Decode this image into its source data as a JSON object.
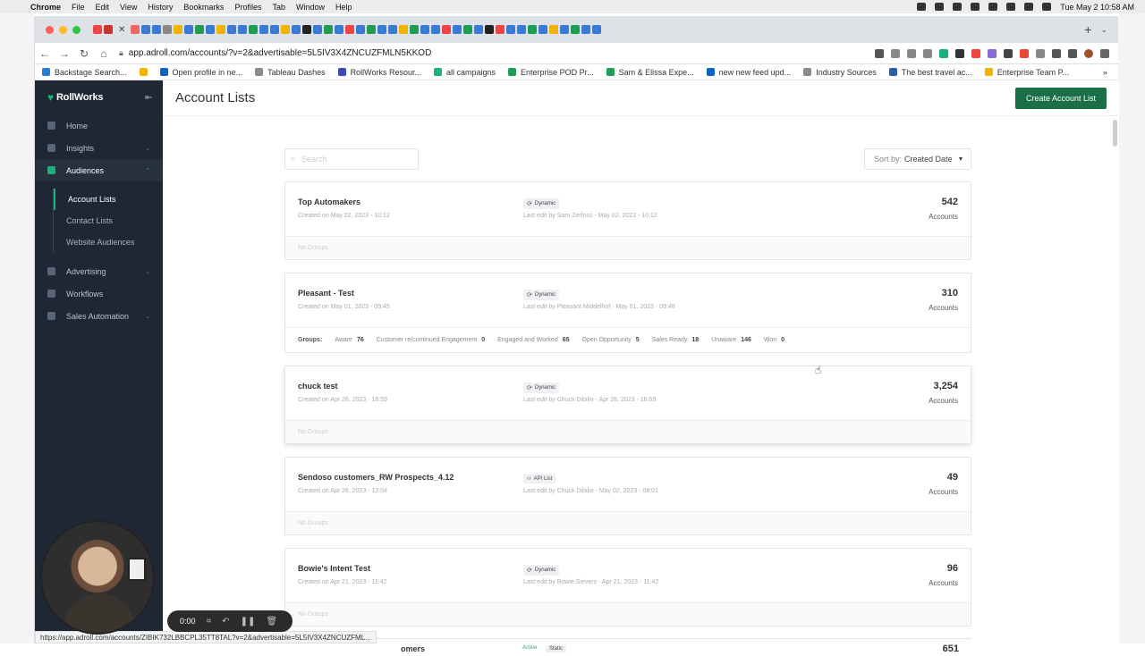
{
  "macos": {
    "menus": [
      "Chrome",
      "File",
      "Edit",
      "View",
      "History",
      "Bookmarks",
      "Profiles",
      "Tab",
      "Window",
      "Help"
    ],
    "clock": "Tue May 2  10:58 AM"
  },
  "browser": {
    "url_host": "app.adroll.com",
    "url_path": "/accounts/?v=2&advertisable=5L5IV3X4ZNCUZFMLN5KKOD",
    "status_url": "https://app.adroll.com/accounts/ZIBIK732LBBCPL35TT8TAL?v=2&advertisable=5L5IV3X4ZNCUZFML...",
    "bookmarks": [
      {
        "label": "Backstage Search...",
        "color": "#2b7cd3"
      },
      {
        "label": "",
        "color": "#f0b400"
      },
      {
        "label": "Open profile in ne...",
        "color": "#0a66c2"
      },
      {
        "label": "Tableau Dashes",
        "color": "#8a8a8a"
      },
      {
        "label": "RollWorks Resour...",
        "color": "#3b4bb0"
      },
      {
        "label": "all campaigns",
        "color": "#19b27a"
      },
      {
        "label": "Enterprise POD Pr...",
        "color": "#1f9d55"
      },
      {
        "label": "Sam & Elissa Expe...",
        "color": "#1f9d55"
      },
      {
        "label": "new new feed upd...",
        "color": "#0a66c2"
      },
      {
        "label": "Industry Sources",
        "color": "#8a8a8a"
      },
      {
        "label": "The best travel ac...",
        "color": "#2b5ca8"
      },
      {
        "label": "Enterprise Team P...",
        "color": "#f0b400"
      }
    ],
    "more_bookmarks": "»"
  },
  "sidebar": {
    "brand": "RollWorks",
    "items": [
      {
        "label": "Home",
        "active": false,
        "chevron": false
      },
      {
        "label": "Insights",
        "active": false,
        "chevron": true
      },
      {
        "label": "Audiences",
        "active": true,
        "chevron": true
      }
    ],
    "subitems": [
      {
        "label": "Account Lists",
        "active": true
      },
      {
        "label": "Contact Lists",
        "active": false
      },
      {
        "label": "Website Audiences",
        "active": false
      }
    ],
    "items_after": [
      {
        "label": "Advertising",
        "chevron": true
      },
      {
        "label": "Workflows",
        "chevron": false
      },
      {
        "label": "Sales Automation",
        "chevron": true
      }
    ]
  },
  "page": {
    "title": "Account Lists",
    "create_button": "Create Account List",
    "search_placeholder": "Search",
    "sort_label": "Sort by:",
    "sort_value": "Created Date"
  },
  "cards": [
    {
      "name": "Top Automakers",
      "created": "Created on May 02, 2023 - 10:12",
      "type": "Dynamic",
      "edit": "Last edit by Sam Zerfoss - May 02, 2023 - 10:12",
      "count": "542",
      "unit": "Accounts",
      "groups_text": "No Groups",
      "groups": []
    },
    {
      "name": "Pleasant - Test",
      "created": "Created on May 01, 2023 - 09:45",
      "type": "Dynamic",
      "edit": "Last edit by Pleasant Middelhof - May 01, 2023 - 09:48",
      "count": "310",
      "unit": "Accounts",
      "groups_label": "Groups:",
      "groups": [
        {
          "name": "Aware",
          "count": "76"
        },
        {
          "name": "Customer re/continued Engagement",
          "count": "0"
        },
        {
          "name": "Engaged and Worked",
          "count": "65"
        },
        {
          "name": "Open Opportunity",
          "count": "5"
        },
        {
          "name": "Sales Ready",
          "count": "18"
        },
        {
          "name": "Unaware",
          "count": "146"
        },
        {
          "name": "Won",
          "count": "0"
        }
      ]
    },
    {
      "name": "chuck test",
      "created": "Created on Apr 26, 2023 - 16:59",
      "type": "Dynamic",
      "edit": "Last edit by Chuck Dibilio - Apr 26, 2023 - 16:59",
      "count": "3,254",
      "unit": "Accounts",
      "groups_text": "No Groups",
      "groups": []
    },
    {
      "name": "Sendoso customers_RW Prospects_4.12",
      "created": "Created on Apr 26, 2023 - 12:04",
      "type": "API List",
      "edit": "Last edit by Chuck Dibilio - May 02, 2023 - 08:01",
      "count": "49",
      "unit": "Accounts",
      "groups_text": "No Groups",
      "groups": []
    },
    {
      "name": "Bowie's Intent Test",
      "created": "Created on Apr 21, 2023 - 11:42",
      "type": "Dynamic",
      "edit": "Last edit by Bowie Sievers - Apr 21, 2023 - 11:42",
      "count": "96",
      "unit": "Accounts",
      "groups_text": "No Groups",
      "groups": []
    }
  ],
  "partial_card": {
    "name_tail": "omers",
    "status": "Active",
    "type": "Static",
    "count": "651"
  },
  "recorder": {
    "time": "0:00"
  },
  "colors": {
    "sidebar_bg": "#1e2733",
    "accent_green": "#19b27a",
    "create_button": "#1a6f47"
  }
}
